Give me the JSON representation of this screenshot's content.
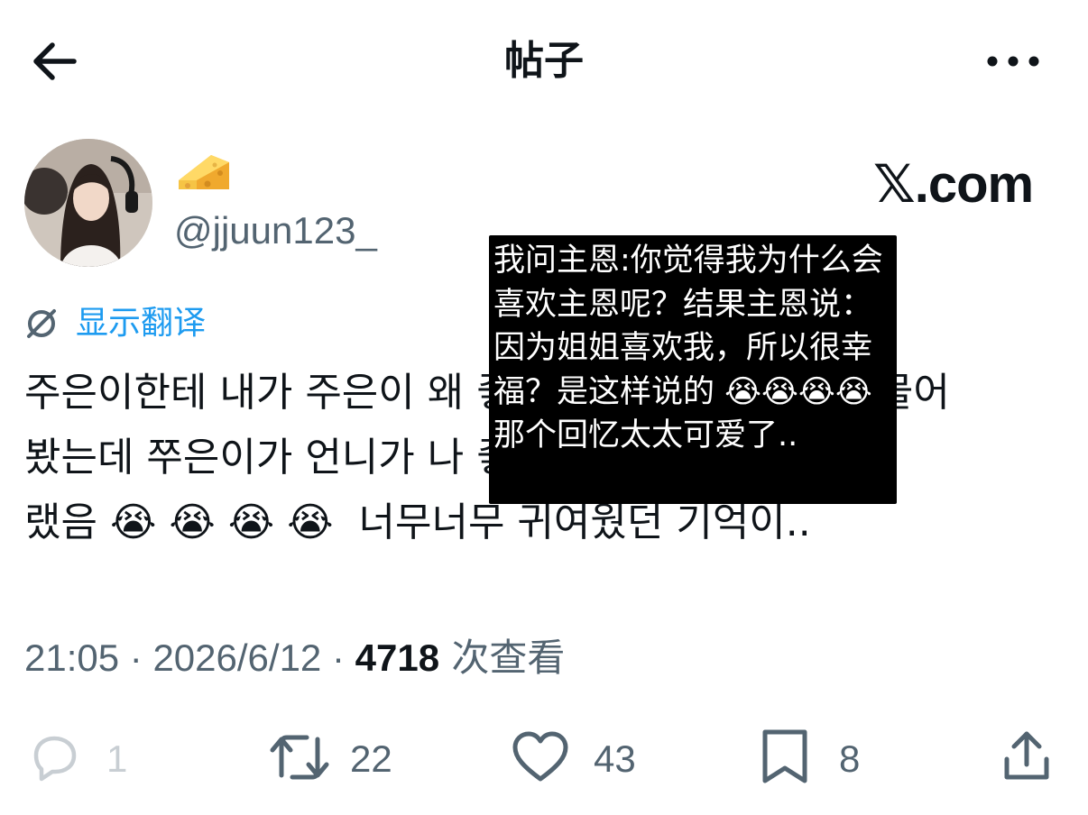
{
  "header": {
    "title": "帖子",
    "back_icon": "arrow-left-icon",
    "more_icon": "more-horizontal-icon"
  },
  "author": {
    "display_name_icon": "cheese-icon",
    "handle": "@jjuun123_"
  },
  "watermark": "𝕏.com",
  "translate": {
    "label": "显示翻译",
    "icon": "translate-icon",
    "color": "#1d9bf0"
  },
  "tweet": {
    "text": "주은이한테 내가 주은이 왜 좋아하는 것 같아? 라고 물어\n봤는데 쭈은이가 언니가 나 좋아해서 행복하니까? 이\n랬음 😭 😭 😭 😭  너무너무 귀여웠던 기억이.."
  },
  "overlay_caption": {
    "text": "我问主恩:你觉得我为什么会喜欢主恩呢？结果主恩说：因为姐姐喜欢我，所以很幸福？是这样说的 😭😭😭😭 那个回忆太太可爱了.."
  },
  "meta": {
    "time": "21:05",
    "separator": " · ",
    "date": "2026/6/12",
    "views_count": "4718",
    "views_label": " 次查看"
  },
  "actions": {
    "reply": {
      "count": "1",
      "icon": "reply-bubble-icon"
    },
    "retweet": {
      "count": "22",
      "icon": "retweet-icon"
    },
    "like": {
      "count": "43",
      "icon": "heart-icon"
    },
    "bookmark": {
      "count": "8",
      "icon": "bookmark-icon"
    },
    "share": {
      "icon": "share-icon"
    }
  },
  "colors": {
    "text_primary": "#0f1419",
    "text_secondary": "#536471",
    "accent": "#1d9bf0",
    "overlay_bg": "#000000"
  }
}
